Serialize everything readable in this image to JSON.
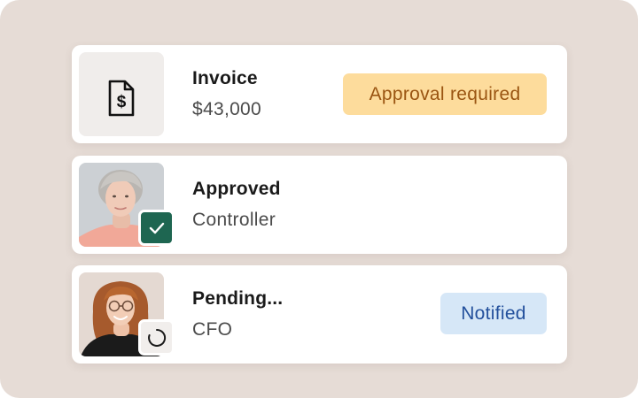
{
  "invoice_card": {
    "icon": "invoice-dollar-icon",
    "title": "Invoice",
    "amount": "$43,000",
    "badge": "Approval required",
    "badge_bg": "#fddc9c",
    "badge_fg": "#9a5512"
  },
  "approved_card": {
    "status": "Approved",
    "role": "Controller",
    "status_icon": "check-icon",
    "status_icon_bg": "#1e6651"
  },
  "pending_card": {
    "status": "Pending...",
    "role": "CFO",
    "status_icon": "loading-spinner-icon",
    "badge": "Notified",
    "badge_bg": "#d6e7f7",
    "badge_fg": "#23509c"
  },
  "colors": {
    "background": "#e6dcd6",
    "card": "#ffffff"
  }
}
